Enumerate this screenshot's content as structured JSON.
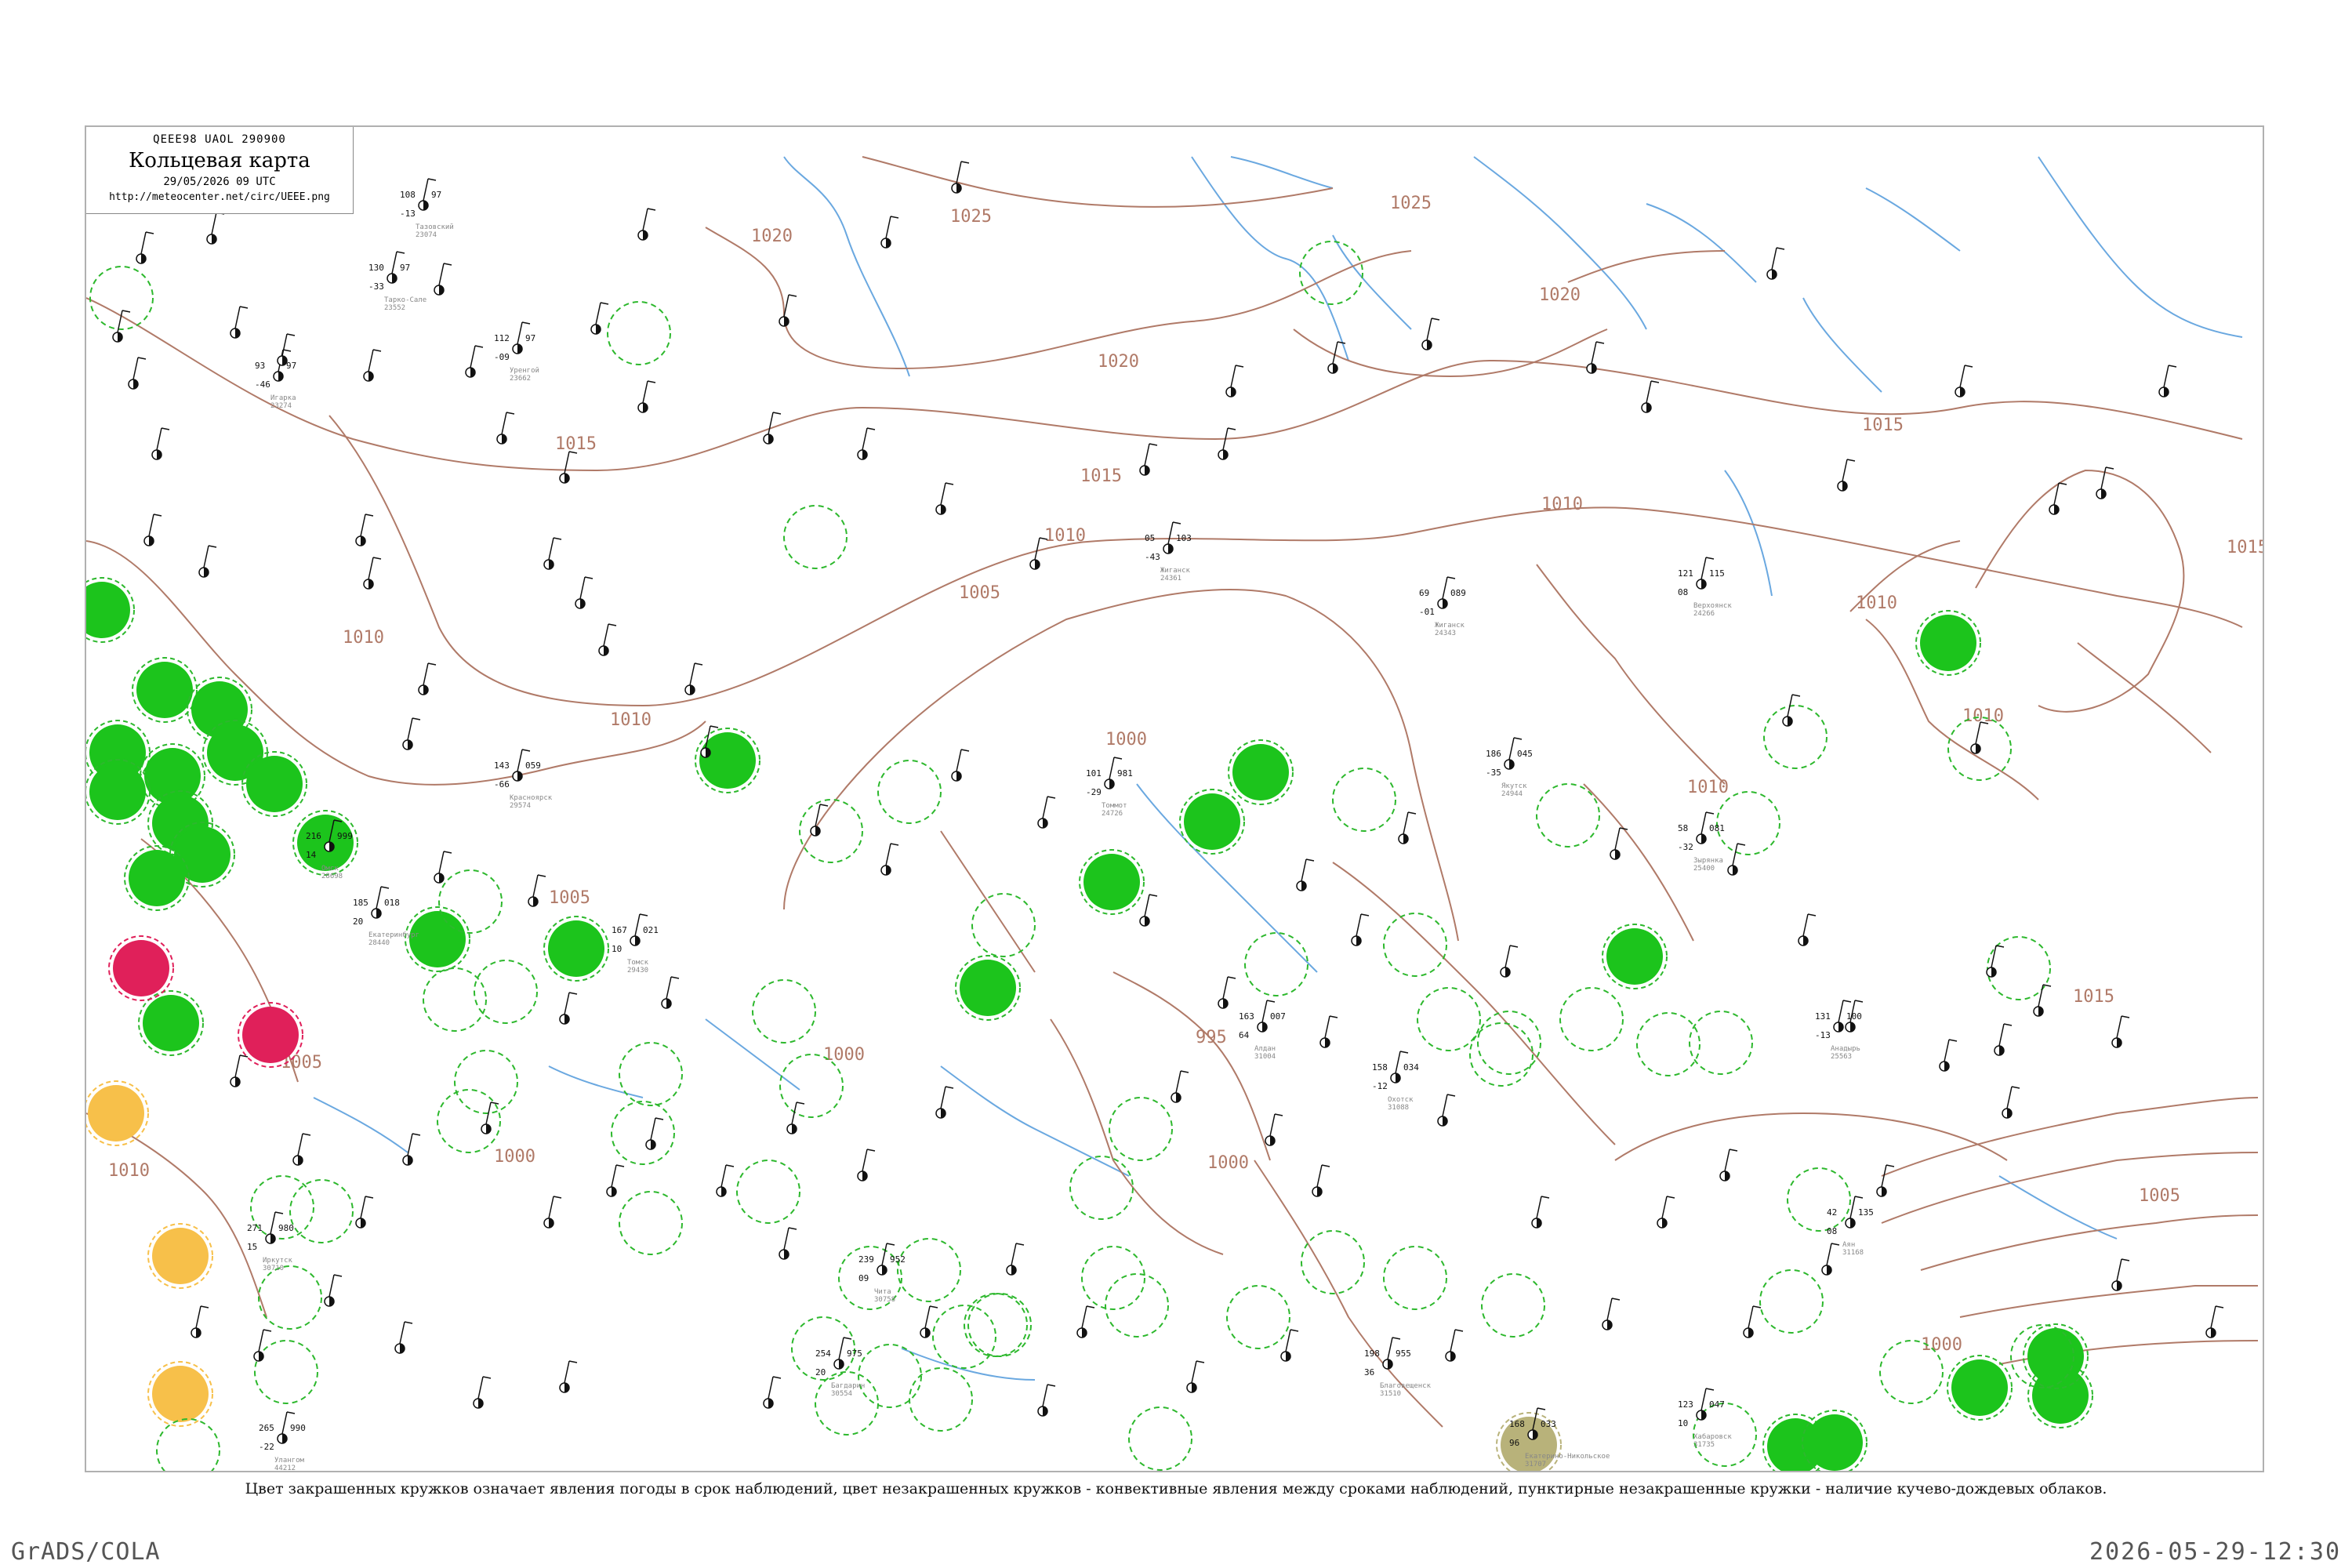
{
  "header": {
    "code": "QEEE98  UAOL  290900",
    "title": "Кольцевая карта",
    "datetime": "29/05/2026 09 UTC",
    "url": "http://meteocenter.net/circ/UEEE.png"
  },
  "caption": "Цвет закрашенных кружков означает явления погоды в срок наблюдений, цвет незакрашенных кружков - конвективные явления между сроками наблюдений, пунктирные незакрашенные кружки - наличие кучево-дождевых облаков.",
  "footer": {
    "left": "GrADS/COLA",
    "right": "2026-05-29-12:30"
  },
  "colors": {
    "isobar": "#b07a68",
    "water": "#6aa8e0",
    "rain_fill": "#1cc41c",
    "rain_ring": "#2db82d",
    "thunder_fill": "#e0205a",
    "fog_fill": "#f7c04a",
    "haze_fill": "#b8b27a",
    "station_text": "#111111"
  },
  "isobars": [
    {
      "label": "1025"
    },
    {
      "label": "1025"
    },
    {
      "label": "1020"
    },
    {
      "label": "1020"
    },
    {
      "label": "1020"
    },
    {
      "label": "1015"
    },
    {
      "label": "1015"
    },
    {
      "label": "1015"
    },
    {
      "label": "1015"
    },
    {
      "label": "1015"
    },
    {
      "label": "1010"
    },
    {
      "label": "1010"
    },
    {
      "label": "1010"
    },
    {
      "label": "1010"
    },
    {
      "label": "1010"
    },
    {
      "label": "1010"
    },
    {
      "label": "1010"
    },
    {
      "label": "1010"
    },
    {
      "label": "1005"
    },
    {
      "label": "1005"
    },
    {
      "label": "1005"
    },
    {
      "label": "1005"
    },
    {
      "label": "1000"
    },
    {
      "label": "1000"
    },
    {
      "label": "1000"
    },
    {
      "label": "1000"
    },
    {
      "label": "1000"
    },
    {
      "label": "995"
    }
  ],
  "stations": [
    {
      "id": "23074",
      "name": "Тазовский",
      "p": "108",
      "t": "97",
      "td": "-13"
    },
    {
      "id": "23552",
      "name": "Тарко-Сале",
      "p": "130",
      "t": "97",
      "td": "-33"
    },
    {
      "id": "23662",
      "name": "Уренгой",
      "p": "112",
      "t": "97",
      "td": "-09"
    },
    {
      "id": "23274",
      "name": "Игарка",
      "p": "93",
      "t": "97",
      "td": "-46"
    },
    {
      "id": "24361",
      "name": "Жиганск",
      "p": "05",
      "t": "103",
      "td": "-43"
    },
    {
      "id": "24343",
      "name": "Жиганск",
      "p": "69",
      "t": "089",
      "td": "-01"
    },
    {
      "id": "24266",
      "name": "Верхоянск",
      "p": "121",
      "t": "115",
      "td": "08"
    },
    {
      "id": "24726",
      "name": "Томмот",
      "p": "101",
      "t": "981",
      "td": "-29"
    },
    {
      "id": "24944",
      "name": "Якутск",
      "p": "186",
      "t": "045",
      "td": "-35"
    },
    {
      "id": "28698",
      "name": "Омск",
      "p": "216",
      "t": "999",
      "td": "14"
    },
    {
      "id": "29430",
      "name": "Томск",
      "p": "167",
      "t": "021",
      "td": "10"
    },
    {
      "id": "29574",
      "name": "Красноярск",
      "p": "143",
      "t": "059",
      "td": "-66"
    },
    {
      "id": "30554",
      "name": "Багдарин",
      "p": "254",
      "t": "975",
      "td": "20"
    },
    {
      "id": "30710",
      "name": "Иркутск",
      "p": "271",
      "t": "980",
      "td": "15"
    },
    {
      "id": "30758",
      "name": "Чита",
      "p": "239",
      "t": "952",
      "td": "09"
    },
    {
      "id": "31004",
      "name": "Алдан",
      "p": "163",
      "t": "007",
      "td": "64"
    },
    {
      "id": "31088",
      "name": "Охотск",
      "p": "158",
      "t": "034",
      "td": "-12"
    },
    {
      "id": "31168",
      "name": "Аян",
      "p": "42",
      "t": "135",
      "td": "08"
    },
    {
      "id": "31510",
      "name": "Благовещенск",
      "p": "198",
      "t": "955",
      "td": "36"
    },
    {
      "id": "31707",
      "name": "Екатерино-Никольское",
      "p": "168",
      "t": "033",
      "td": "96"
    },
    {
      "id": "31735",
      "name": "Хабаровск",
      "p": "123",
      "t": "047",
      "td": "10"
    },
    {
      "id": "25563",
      "name": "Анадырь",
      "p": "131",
      "t": "100",
      "td": "-13"
    },
    {
      "id": "25400",
      "name": "Зырянка",
      "p": "58",
      "t": "081",
      "td": "-32"
    },
    {
      "id": "28440",
      "name": "Екатеринбург",
      "p": "185",
      "t": "018",
      "td": "20"
    },
    {
      "id": "44212",
      "name": "Улангом",
      "p": "265",
      "t": "990",
      "td": "-22"
    }
  ]
}
